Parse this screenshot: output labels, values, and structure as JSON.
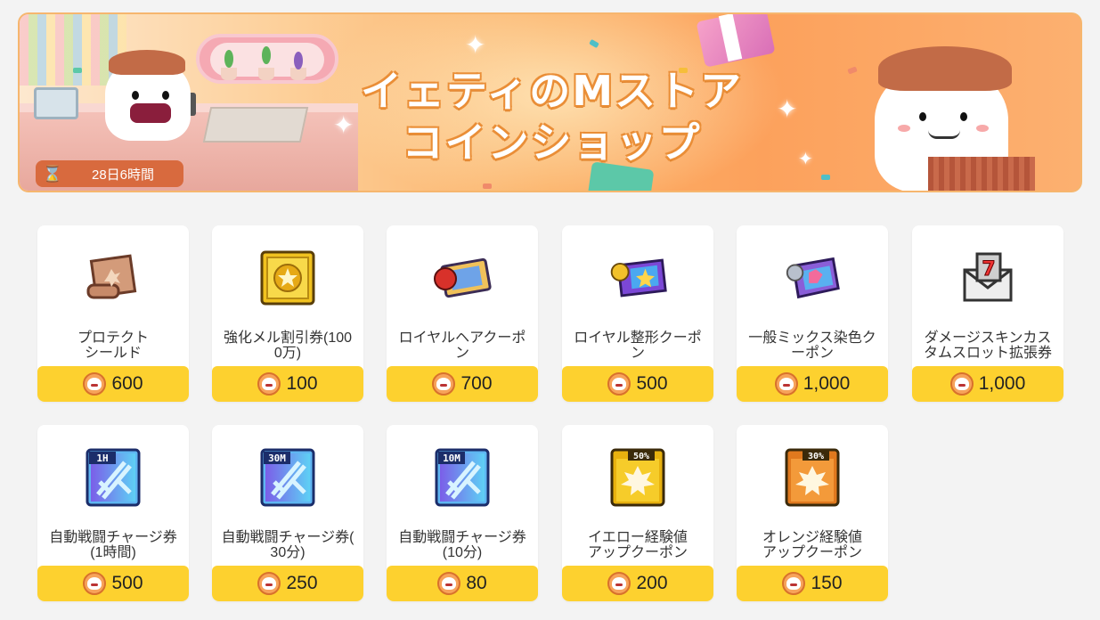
{
  "banner": {
    "title_line1": "イェティのMストア",
    "title_line2": "コインショップ",
    "timer": "28日6時間",
    "colors": {
      "accent": "#fbb066",
      "timer_bg": "#d86a3e"
    }
  },
  "currency_icon": "yeti-coin-icon",
  "items": [
    {
      "name_lines": [
        "プロテクト",
        "シールド"
      ],
      "price": "600",
      "icon": "scroll-icon"
    },
    {
      "name_lines": [
        "強化メル割引券(100",
        "0万)"
      ],
      "price": "100",
      "icon": "gold-coin-coupon-icon"
    },
    {
      "name_lines": [
        "ロイヤルヘアクーポ",
        "ン"
      ],
      "price": "700",
      "icon": "royal-hair-coupon-icon"
    },
    {
      "name_lines": [
        "ロイヤル整形クーポ",
        "ン"
      ],
      "price": "500",
      "icon": "royal-face-coupon-icon"
    },
    {
      "name_lines": [
        "一般ミックス染色ク",
        "ーポン"
      ],
      "price": "1,000",
      "icon": "mix-dye-coupon-icon"
    },
    {
      "name_lines": [
        "ダメージスキンカス",
        "タムスロット拡張券"
      ],
      "price": "1,000",
      "icon": "damage-skin-envelope-icon"
    },
    {
      "name_lines": [
        "自動戦闘チャージ券",
        "(1時間)"
      ],
      "price": "500",
      "icon": "auto-battle-1h-icon",
      "tag": "1H"
    },
    {
      "name_lines": [
        "自動戦闘チャージ券(",
        "30分)"
      ],
      "price": "250",
      "icon": "auto-battle-30m-icon",
      "tag": "30M"
    },
    {
      "name_lines": [
        "自動戦闘チャージ券",
        "(10分)"
      ],
      "price": "80",
      "icon": "auto-battle-10m-icon",
      "tag": "10M"
    },
    {
      "name_lines": [
        "イエロー経験値",
        "アップクーポン"
      ],
      "price": "200",
      "icon": "yellow-exp-coupon-icon",
      "tag": "50%"
    },
    {
      "name_lines": [
        "オレンジ経験値",
        "アップクーポン"
      ],
      "price": "150",
      "icon": "orange-exp-coupon-icon",
      "tag": "30%"
    }
  ]
}
